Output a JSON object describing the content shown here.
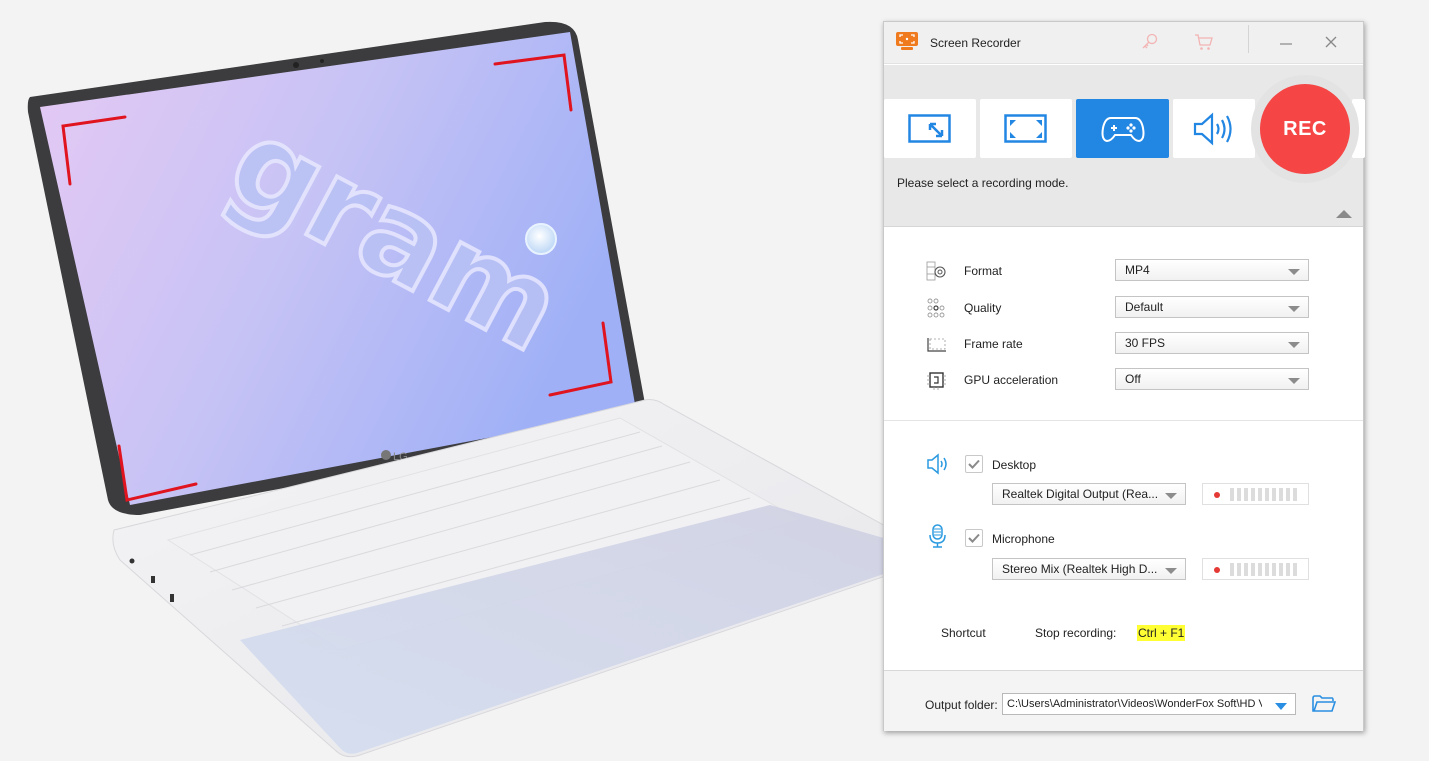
{
  "background_image": {
    "description": "LG gram laptop with red recording-area corner brackets on screen",
    "logo_text": "LG",
    "wallpaper_text": "gram",
    "accent_bracket_color": "#e0141e"
  },
  "window": {
    "title": "Screen Recorder",
    "titlebar_icons": [
      "register-key-icon",
      "cart-icon"
    ],
    "minimize_label": "—",
    "close_label": "✕"
  },
  "modes": {
    "items": [
      {
        "name": "region-mode",
        "icon": "region-select-icon",
        "active": false
      },
      {
        "name": "fullscreen-mode",
        "icon": "fullscreen-icon",
        "active": false
      },
      {
        "name": "game-mode",
        "icon": "gamepad-icon",
        "active": true
      },
      {
        "name": "audio-only-mode",
        "icon": "speaker-icon",
        "active": false
      }
    ],
    "rec_label": "REC",
    "hint": "Please select a recording mode.",
    "accent_color": "#2286e3",
    "rec_color": "#f54545"
  },
  "settings": [
    {
      "label": "Format",
      "value": "MP4",
      "icon": "format-gear-icon"
    },
    {
      "label": "Quality",
      "value": "Default",
      "icon": "quality-dots-icon"
    },
    {
      "label": "Frame rate",
      "value": "30 FPS",
      "icon": "frame-rate-icon"
    },
    {
      "label": "GPU acceleration",
      "value": "Off",
      "icon": "gpu-chip-icon"
    }
  ],
  "audio": {
    "desktop": {
      "label": "Desktop",
      "checked": true,
      "device": "Realtek Digital Output (Rea...",
      "level": 0
    },
    "microphone": {
      "label": "Microphone",
      "checked": true,
      "device": "Stereo Mix (Realtek High D...",
      "level": 0
    }
  },
  "shortcut": {
    "label": "Shortcut",
    "action": "Stop recording:",
    "keys": "Ctrl + F1"
  },
  "output": {
    "label": "Output folder:",
    "path": "C:\\Users\\Administrator\\Videos\\WonderFox Soft\\HD Video Converter Factory Pro\\Recorder"
  }
}
